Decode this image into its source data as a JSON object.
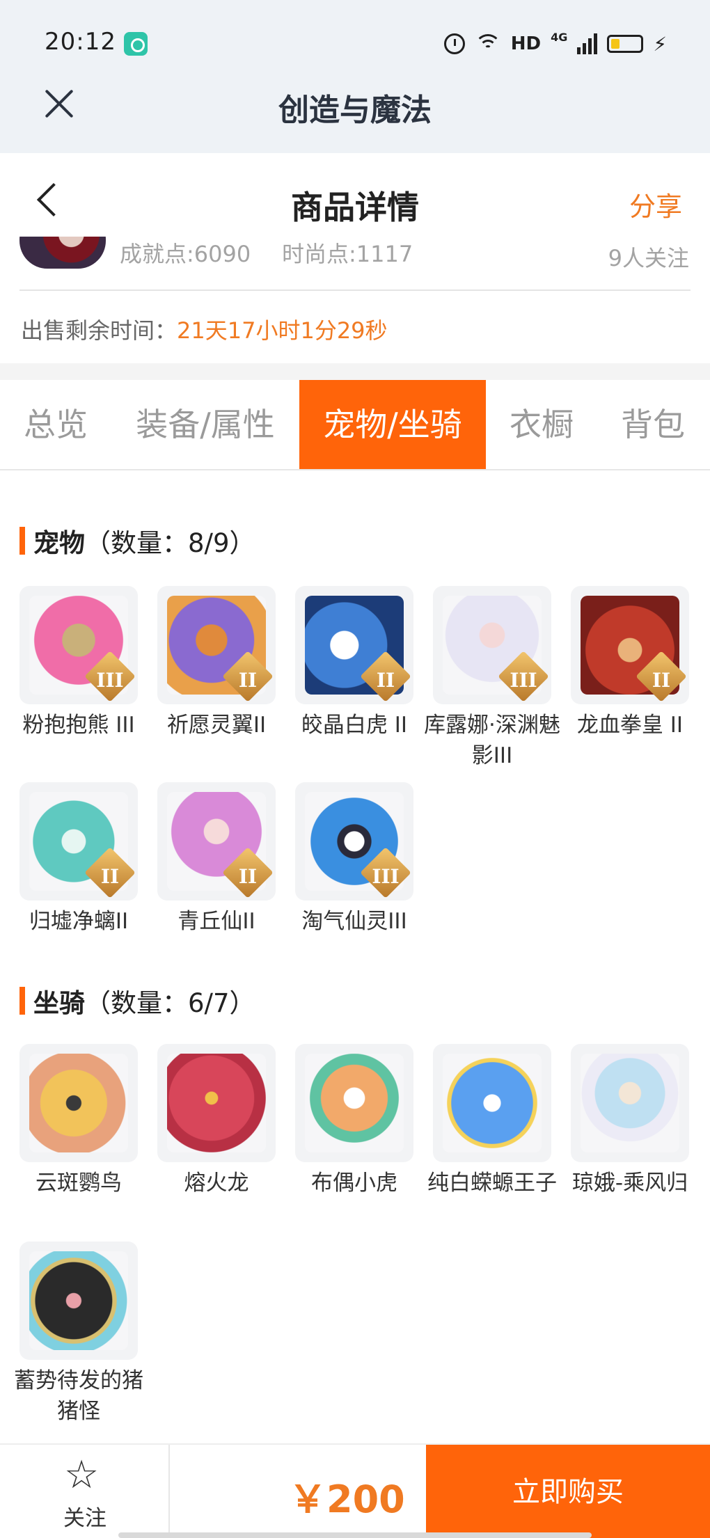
{
  "status_bar": {
    "time": "20:12",
    "network_label": "HD",
    "network_type": "4G",
    "icons": [
      "app-notification-icon",
      "alarm-icon",
      "wifi-icon",
      "signal-icon",
      "battery-icon",
      "charging-icon"
    ]
  },
  "app_header": {
    "title": "创造与魔法"
  },
  "nav": {
    "title": "商品详情",
    "share": "分享"
  },
  "info": {
    "achievement": "成就点:6090",
    "fashion": "时尚点:1117",
    "followers": "9人关注"
  },
  "sale": {
    "label": "出售剩余时间：",
    "value": "21天17小时1分29秒"
  },
  "tabs": [
    {
      "label": "总览",
      "active": false
    },
    {
      "label": "装备/属性",
      "active": false
    },
    {
      "label": "宠物/坐骑",
      "active": true
    },
    {
      "label": "衣橱",
      "active": false
    },
    {
      "label": "背包",
      "active": false
    }
  ],
  "pets": {
    "name": "宠物",
    "count": "（数量：8/9）",
    "items": [
      {
        "name": "粉抱抱熊 III",
        "tier": "III"
      },
      {
        "name": "祈愿灵翼II",
        "tier": "II"
      },
      {
        "name": "皎晶白虎 II",
        "tier": "II"
      },
      {
        "name": "库露娜·深渊魅影III",
        "tier": "III"
      },
      {
        "name": "龙血拳皇 II",
        "tier": "II"
      },
      {
        "name": "归墟净螭II",
        "tier": "II"
      },
      {
        "name": "青丘仙II",
        "tier": "II"
      },
      {
        "name": "淘气仙灵III",
        "tier": "III"
      }
    ]
  },
  "mounts": {
    "name": "坐骑",
    "count": "（数量：6/7）",
    "items": [
      {
        "name": "云斑鹦鸟"
      },
      {
        "name": "熔火龙"
      },
      {
        "name": "布偶小虎"
      },
      {
        "name": "纯白蝾螈王子"
      },
      {
        "name": "琼娥-乘风归"
      },
      {
        "name": "蓄势待发的猪猪怪"
      }
    ]
  },
  "bottom": {
    "follow": "关注",
    "price": "￥200",
    "buy": "立即购买"
  },
  "colors": {
    "accent": "#ff640a",
    "price": "#f07a22",
    "header_bg": "#eef2f6"
  }
}
